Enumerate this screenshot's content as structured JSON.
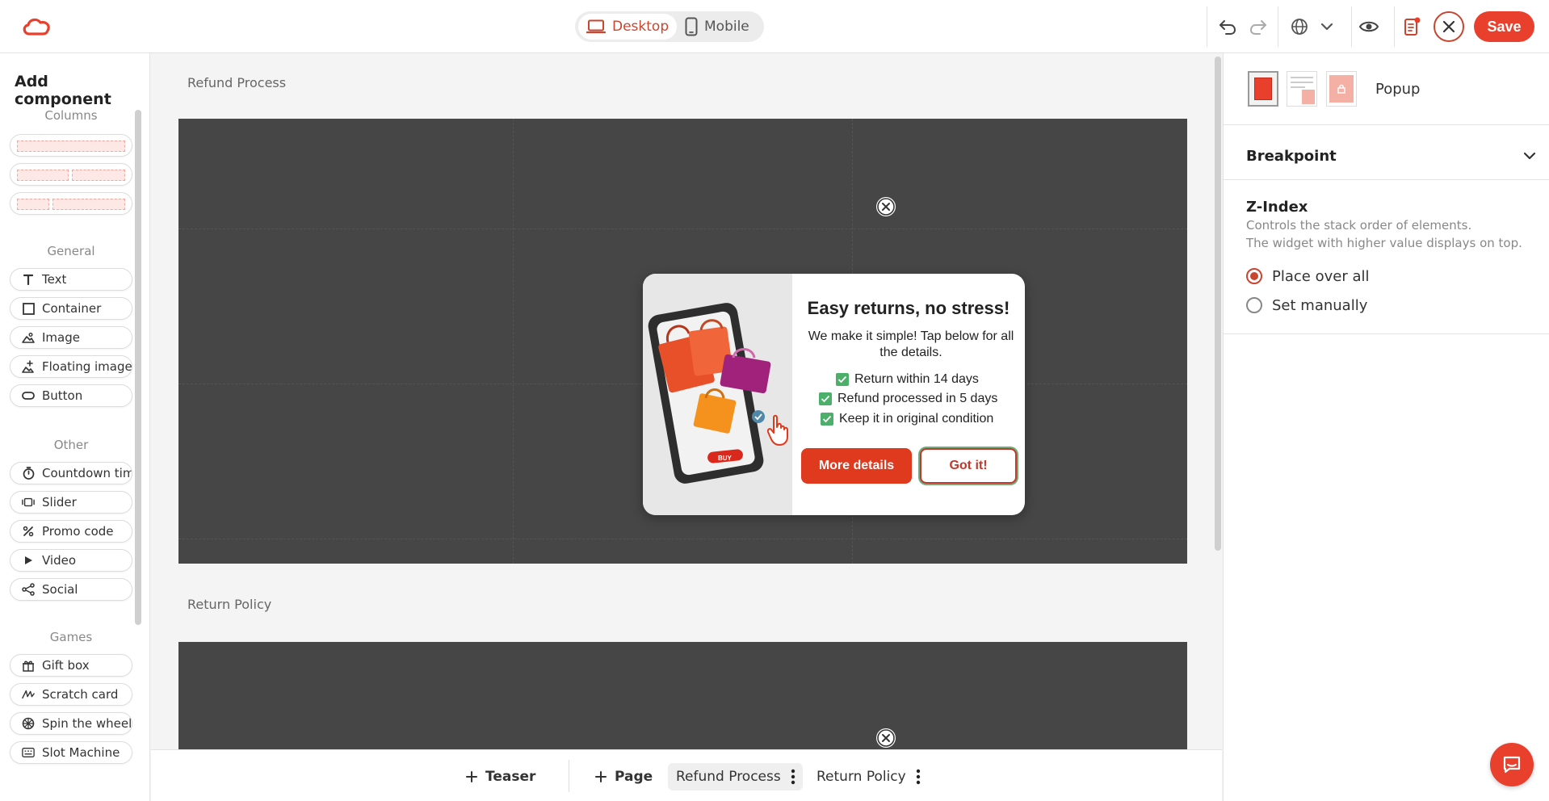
{
  "topbar": {
    "device_desktop": "Desktop",
    "device_mobile": "Mobile",
    "save_label": "Save"
  },
  "sidebar": {
    "title": "Add component",
    "sections": {
      "columns": "Columns",
      "general": "General",
      "other": "Other",
      "games": "Games"
    },
    "general_items": [
      "Text",
      "Container",
      "Image",
      "Floating image",
      "Button"
    ],
    "other_items": [
      "Countdown timer",
      "Slider",
      "Promo code",
      "Video",
      "Social"
    ],
    "games_items": [
      "Gift box",
      "Scratch card",
      "Spin the wheel",
      "Slot Machine"
    ]
  },
  "canvas": {
    "section1_label": "Refund Process",
    "section2_label": "Return Policy"
  },
  "popup": {
    "title": "Easy returns, no stress!",
    "subtitle": "We make it simple! Tap below for all the details.",
    "checklist": [
      "Return within 14 days",
      "Refund processed in 5 days",
      "Keep it in original condition"
    ],
    "btn_more": "More details",
    "btn_got": "Got it!",
    "buy_tag": "BUY"
  },
  "bottombar": {
    "teaser": "Teaser",
    "page": "Page",
    "tab_refund": "Refund Process",
    "tab_return": "Return Policy"
  },
  "right_panel": {
    "type_label": "Popup",
    "breakpoint_label": "Breakpoint",
    "zindex_title": "Z-Index",
    "zindex_desc1": "Controls the stack order of elements.",
    "zindex_desc2": "The widget with higher value displays on top.",
    "option_over_all": "Place over all",
    "option_manual": "Set manually"
  },
  "colors": {
    "accent": "#e8402c",
    "dark_canvas": "#464646",
    "check_green": "#4caf6a"
  }
}
